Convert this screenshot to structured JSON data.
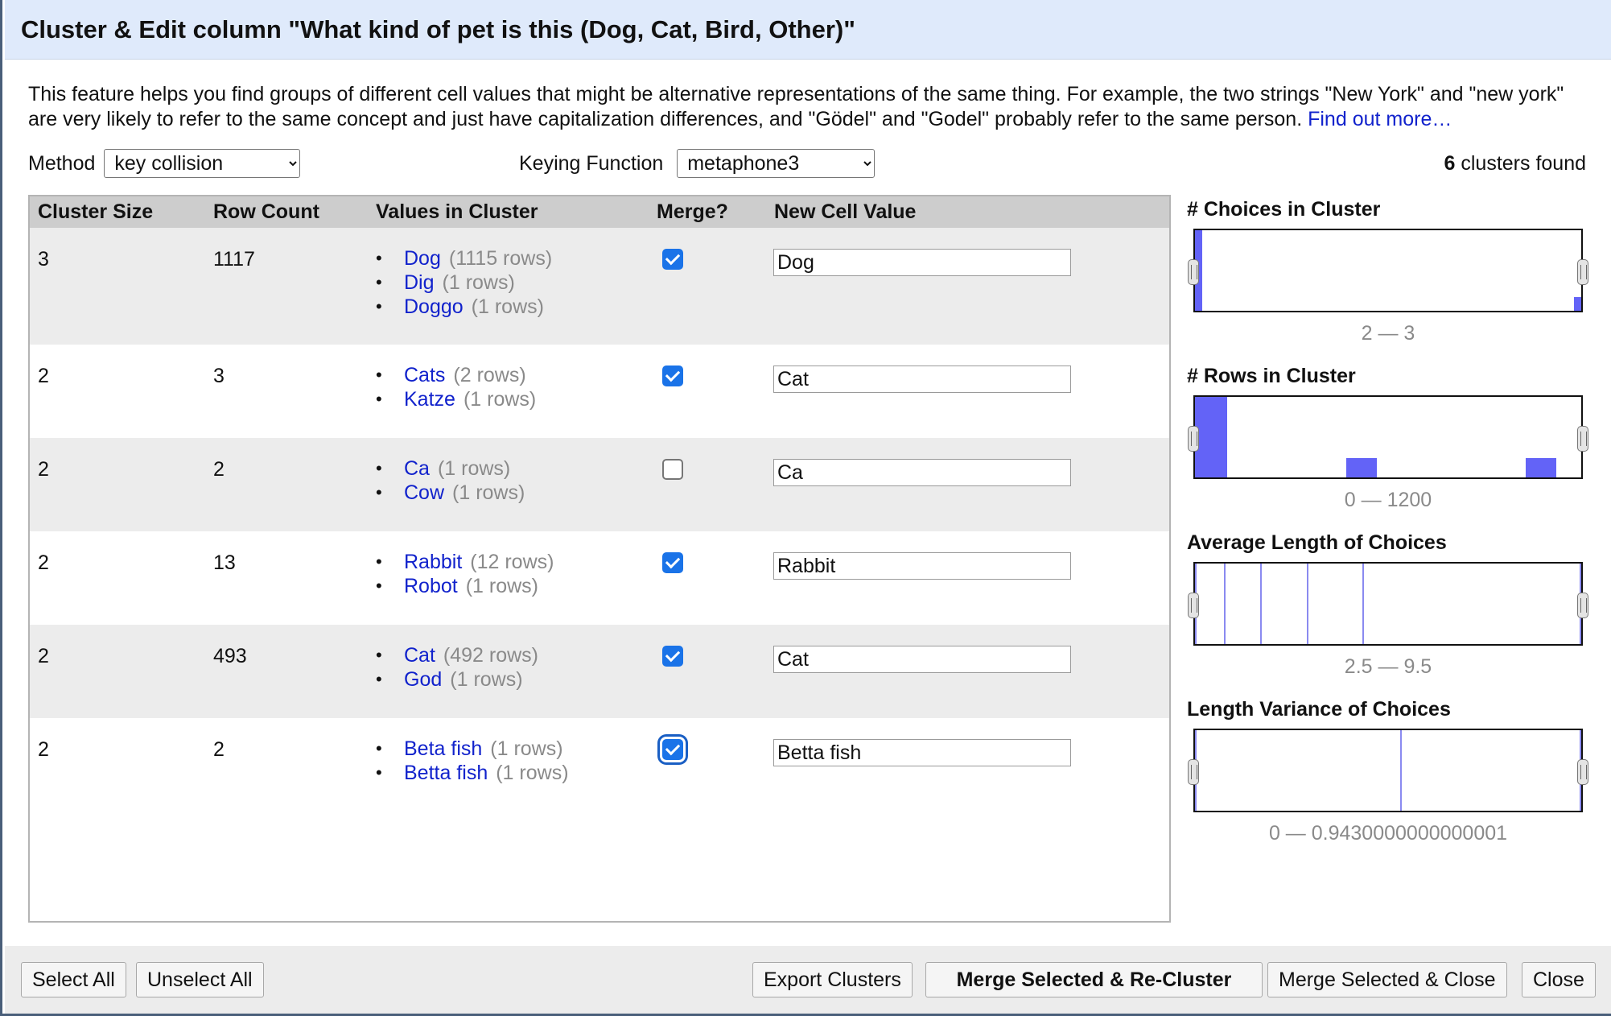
{
  "dialog": {
    "title": "Cluster & Edit column \"What kind of pet is this (Dog, Cat, Bird, Other)\"",
    "description": "This feature helps you find groups of different cell values that might be alternative representations of the same thing. For example, the two strings \"New York\" and \"new york\" are very likely to refer to the same concept and just have capitalization differences, and \"Gödel\" and \"Godel\" probably refer to the same person.",
    "find_out_more": "Find out more…"
  },
  "controls": {
    "method_label": "Method",
    "method_value": "key collision",
    "keying_label": "Keying Function",
    "keying_value": "metaphone3",
    "clusters_count": "6",
    "clusters_found_label": "clusters found"
  },
  "table": {
    "headers": [
      "Cluster Size",
      "Row Count",
      "Values in Cluster",
      "Merge?",
      "New Cell Value"
    ],
    "rows": [
      {
        "size": "3",
        "count": "1117",
        "merge": true,
        "new_value": "Dog",
        "values": [
          {
            "v": "Dog",
            "rc": "(1115 rows)"
          },
          {
            "v": "Dig",
            "rc": "(1 rows)"
          },
          {
            "v": "Doggo",
            "rc": "(1 rows)"
          }
        ]
      },
      {
        "size": "2",
        "count": "3",
        "merge": true,
        "new_value": "Cat",
        "values": [
          {
            "v": "Cats",
            "rc": "(2 rows)"
          },
          {
            "v": "Katze",
            "rc": "(1 rows)"
          }
        ]
      },
      {
        "size": "2",
        "count": "2",
        "merge": false,
        "new_value": "Ca",
        "values": [
          {
            "v": "Ca",
            "rc": "(1 rows)"
          },
          {
            "v": "Cow",
            "rc": "(1 rows)"
          }
        ]
      },
      {
        "size": "2",
        "count": "13",
        "merge": true,
        "new_value": "Rabbit",
        "values": [
          {
            "v": "Rabbit",
            "rc": "(12 rows)"
          },
          {
            "v": "Robot",
            "rc": "(1 rows)"
          }
        ]
      },
      {
        "size": "2",
        "count": "493",
        "merge": true,
        "new_value": "Cat",
        "values": [
          {
            "v": "Cat",
            "rc": "(492 rows)"
          },
          {
            "v": "God",
            "rc": "(1 rows)"
          }
        ]
      },
      {
        "size": "2",
        "count": "2",
        "merge": true,
        "new_value": "Betta fish",
        "values": [
          {
            "v": "Beta fish",
            "rc": "(1 rows)"
          },
          {
            "v": "Betta fish",
            "rc": "(1 rows)"
          }
        ]
      }
    ]
  },
  "facets": [
    {
      "title": "# Choices in Cluster",
      "range": "2 — 3"
    },
    {
      "title": "# Rows in Cluster",
      "range": "0 — 1200"
    },
    {
      "title": "Average Length of Choices",
      "range": "2.5 — 9.5"
    },
    {
      "title": "Length Variance of Choices",
      "range": "0 — 0.9430000000000001"
    }
  ],
  "footer": {
    "select_all": "Select All",
    "unselect_all": "Unselect All",
    "export_clusters": "Export Clusters",
    "merge_recluster": "Merge Selected & Re-Cluster",
    "merge_close": "Merge Selected & Close",
    "close": "Close"
  },
  "colors": {
    "title_bar": "#dfeafb",
    "link": "#1122cc",
    "histogram_bar": "#6363f7",
    "checkbox_checked": "#1a73e8"
  }
}
